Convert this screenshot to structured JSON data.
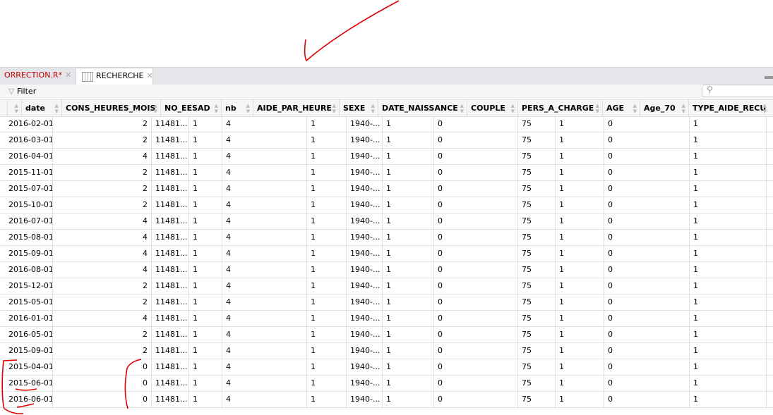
{
  "tabs": [
    {
      "label": "ORRECTION.R*",
      "modified": true
    },
    {
      "label": "RECHERCHE"
    }
  ],
  "toolbar": {
    "filter_label": "Filter",
    "search_placeholder": ""
  },
  "columns": [
    "",
    "date",
    "CONS_HEURES_MOIS",
    "NO_EESAD",
    "nb",
    "AIDE_PAR_HEURE",
    "SEXE",
    "DATE_NAISSANCE",
    "COUPLE",
    "PERS_A_CHARGE",
    "AGE",
    "Age_70",
    "TYPE_AIDE_RECU"
  ],
  "rows": [
    [
      "2016-02-01",
      "2",
      "11481...",
      "1",
      "4",
      "1",
      "1940-...",
      "1",
      "0",
      "75",
      "1",
      "0",
      "1"
    ],
    [
      "2016-03-01",
      "2",
      "11481...",
      "1",
      "4",
      "1",
      "1940-...",
      "1",
      "0",
      "75",
      "1",
      "0",
      "1"
    ],
    [
      "2016-04-01",
      "4",
      "11481...",
      "1",
      "4",
      "1",
      "1940-...",
      "1",
      "0",
      "75",
      "1",
      "0",
      "1"
    ],
    [
      "2015-11-01",
      "2",
      "11481...",
      "1",
      "4",
      "1",
      "1940-...",
      "1",
      "0",
      "75",
      "1",
      "0",
      "1"
    ],
    [
      "2015-07-01",
      "2",
      "11481...",
      "1",
      "4",
      "1",
      "1940-...",
      "1",
      "0",
      "75",
      "1",
      "0",
      "1"
    ],
    [
      "2015-10-01",
      "2",
      "11481...",
      "1",
      "4",
      "1",
      "1940-...",
      "1",
      "0",
      "75",
      "1",
      "0",
      "1"
    ],
    [
      "2016-07-01",
      "4",
      "11481...",
      "1",
      "4",
      "1",
      "1940-...",
      "1",
      "0",
      "75",
      "1",
      "0",
      "1"
    ],
    [
      "2015-08-01",
      "4",
      "11481...",
      "1",
      "4",
      "1",
      "1940-...",
      "1",
      "0",
      "75",
      "1",
      "0",
      "1"
    ],
    [
      "2015-09-01",
      "4",
      "11481...",
      "1",
      "4",
      "1",
      "1940-...",
      "1",
      "0",
      "75",
      "1",
      "0",
      "1"
    ],
    [
      "2016-08-01",
      "4",
      "11481...",
      "1",
      "4",
      "1",
      "1940-...",
      "1",
      "0",
      "75",
      "1",
      "0",
      "1"
    ],
    [
      "2015-12-01",
      "2",
      "11481...",
      "1",
      "4",
      "1",
      "1940-...",
      "1",
      "0",
      "75",
      "1",
      "0",
      "1"
    ],
    [
      "2015-05-01",
      "2",
      "11481...",
      "1",
      "4",
      "1",
      "1940-...",
      "1",
      "0",
      "75",
      "1",
      "0",
      "1"
    ],
    [
      "2016-01-01",
      "4",
      "11481...",
      "1",
      "4",
      "1",
      "1940-...",
      "1",
      "0",
      "75",
      "1",
      "0",
      "1"
    ],
    [
      "2016-05-01",
      "2",
      "11481...",
      "1",
      "4",
      "1",
      "1940-...",
      "1",
      "0",
      "75",
      "1",
      "0",
      "1"
    ],
    [
      "2015-09-01",
      "2",
      "11481...",
      "1",
      "4",
      "1",
      "1940-...",
      "1",
      "0",
      "75",
      "1",
      "0",
      "1"
    ],
    [
      "2015-04-01",
      "0",
      "11481...",
      "1",
      "4",
      "1",
      "1940-...",
      "1",
      "0",
      "75",
      "1",
      "0",
      "1"
    ],
    [
      "2015-06-01",
      "0",
      "11481...",
      "1",
      "4",
      "1",
      "1940-...",
      "1",
      "0",
      "75",
      "1",
      "0",
      "1"
    ],
    [
      "2016-06-01",
      "0",
      "11481...",
      "1",
      "4",
      "1",
      "1940-...",
      "1",
      "0",
      "75",
      "1",
      "0",
      "1"
    ]
  ],
  "colors": {
    "annotation": "#e00000",
    "modified_tab": "#c00000"
  }
}
